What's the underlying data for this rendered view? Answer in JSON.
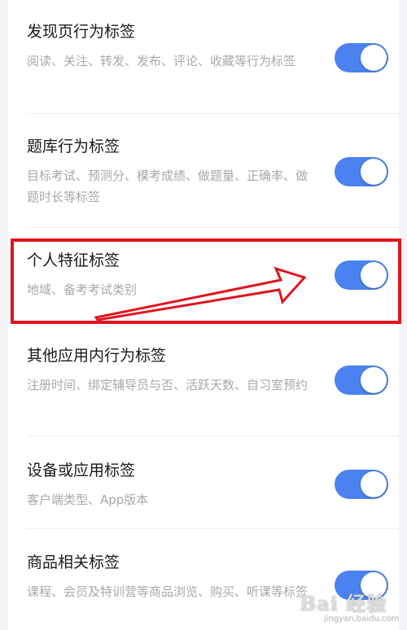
{
  "settings": [
    {
      "title": "发现页行为标签",
      "description": "阅读、关注、转发、发布、评论、收藏等行为标签",
      "enabled": true
    },
    {
      "title": "题库行为标签",
      "description": "目标考试、预测分、模考成绩、做题量、正确率、做题时长等标签",
      "enabled": true
    },
    {
      "title": "个人特征标签",
      "description": "地域、备考考试类别",
      "enabled": true
    },
    {
      "title": "其他应用内行为标签",
      "description": "注册时间、绑定辅导员与否、活跃天数、自习室预约",
      "enabled": true
    },
    {
      "title": "设备或应用标签",
      "description": "客户端类型、App版本",
      "enabled": true
    },
    {
      "title": "商品相关标签",
      "description": "课程、会员及特训营等商品浏览、购买、听课等标签",
      "enabled": true
    }
  ],
  "annotation": {
    "highlighted_item": "个人特征标签",
    "color": "#e0141e"
  },
  "colors": {
    "toggle_on": "#4a82f0",
    "title": "#1a1a1a",
    "description": "#a8a8a8"
  },
  "watermark": {
    "logo": "Bai 经验",
    "url": "jingyan.baidu.com"
  }
}
